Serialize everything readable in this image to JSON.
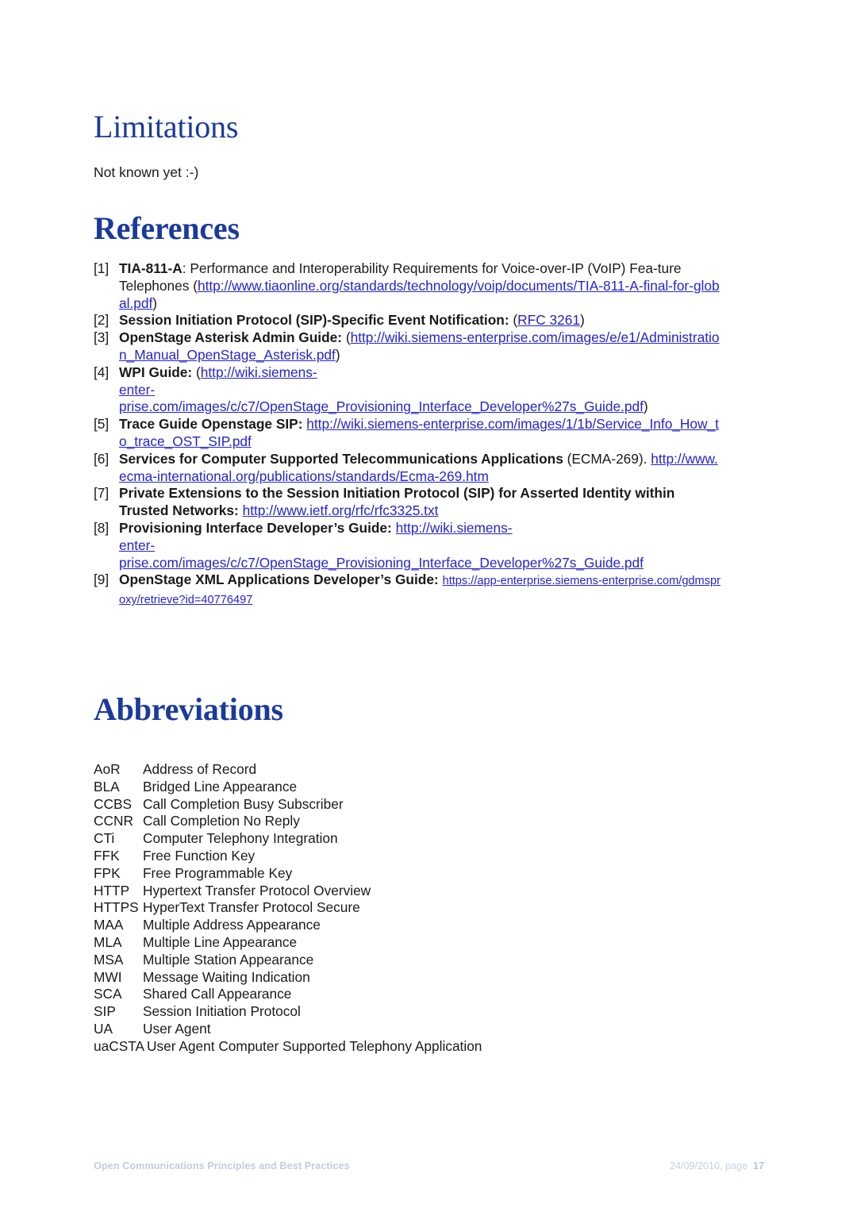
{
  "page": {
    "background": "#ffffff",
    "heading_color": "#1a3a9c",
    "link_color": "#2424cf",
    "text_color": "#1a1a1a",
    "footer_color": "#c3ccdd"
  },
  "sections": {
    "limitations": {
      "heading": "Limitations",
      "paragraph": "Not known yet :-)"
    },
    "references": {
      "heading": "References"
    },
    "abbreviations": {
      "heading": "Abbreviations"
    }
  },
  "references": [
    {
      "num": "[1]",
      "title": "TIA-811-A",
      "after_title": ": Performance and Interoperability Requirements for Voice-over-IP (VoIP) Fea-ture Telephones (",
      "link": "http://www.tiaonline.org/standards/technology/voip/documents/TIA-811-A-final-for-global.pdf",
      "tail": ")"
    },
    {
      "num": "[2]",
      "title": "Session Initiation Protocol (SIP)-Specific Event Notification:",
      "after_title": " (",
      "link": "RFC 3261",
      "tail": ")"
    },
    {
      "num": "[3]",
      "title": "OpenStage Asterisk Admin Guide:",
      "after_title": " (",
      "link": "http://wiki.siemens-enterprise.com/images/e/e1/Administration_Manual_OpenStage_Asterisk.pdf",
      "tail": ")"
    },
    {
      "num": "[4]",
      "title": "WPI Guide:",
      "after_title": " (",
      "link_part1": "http://wiki.siemens-",
      "link_part2": "enter-",
      "link_part3": "prise.com/images/c/c7/OpenStage_Provisioning_Interface_Developer%27s_Guide.pdf",
      "tail": ")"
    },
    {
      "num": "[5]",
      "title": "Trace Guide Openstage SIP:",
      "after_title": " ",
      "link": "http://wiki.siemens-enterprise.com/images/1/1b/Service_Info_How_to_trace_OST_SIP.pdf",
      "tail": ""
    },
    {
      "num": "[6]",
      "title": "Services for Computer Supported Telecommunications Applications",
      "after_title": " (ECMA-269). ",
      "link": "http://www.ecma-international.org/publications/standards/Ecma-269.htm",
      "tail": ""
    },
    {
      "num": "[7]",
      "title": "Private Extensions to the Session Initiation Protocol (SIP) for Asserted Identity within Trusted Networks:",
      "after_title": " ",
      "link": "http://www.ietf.org/rfc/rfc3325.txt",
      "tail": ""
    },
    {
      "num": "[8]",
      "title": "Provisioning Interface Developer’s Guide:",
      "after_title": " ",
      "link_part1": "http://wiki.siemens-",
      "link_part2": "enter-",
      "link_part3": "prise.com/images/c/c7/OpenStage_Provisioning_Interface_Developer%27s_Guide.pdf",
      "tail": ""
    },
    {
      "num": "[9]",
      "title": "OpenStage XML Applications Developer’s Guide:",
      "after_title": " ",
      "link": "https://app-enterprise.siemens-enterprise.com/gdmsproxy/retrieve?id=40776497",
      "tail": ""
    }
  ],
  "abbreviations": [
    {
      "key": "AoR",
      "value": "Address of Record"
    },
    {
      "key": "BLA",
      "value": "Bridged Line Appearance"
    },
    {
      "key": "CCBS",
      "value": "Call Completion Busy Subscriber"
    },
    {
      "key": "CCNR",
      "value": "Call Completion No Reply"
    },
    {
      "key": "CTi",
      "value": "Computer Telephony Integration"
    },
    {
      "key": "FFK",
      "value": "Free Function Key"
    },
    {
      "key": "FPK",
      "value": "Free Programmable Key"
    },
    {
      "key": "HTTP",
      "value": "Hypertext Transfer Protocol Overview"
    },
    {
      "key": "HTTPS",
      "value": "HyperText Transfer Protocol Secure"
    },
    {
      "key": "MAA",
      "value": "Multiple Address Appearance"
    },
    {
      "key": "MLA",
      "value": "Multiple Line Appearance"
    },
    {
      "key": "MSA",
      "value": "Multiple Station Appearance"
    },
    {
      "key": "MWI",
      "value": "Message Waiting Indication"
    },
    {
      "key": "SCA",
      "value": "Shared Call Appearance"
    },
    {
      "key": "SIP",
      "value": "Session Initiation Protocol"
    },
    {
      "key": "UA",
      "value": "User Agent"
    },
    {
      "key": "uaCSTA",
      "value": "User Agent Computer Supported Telephony Application",
      "wide": true
    }
  ],
  "footer": {
    "left": "Open Communications Principles and Best Practices",
    "date_label": "24/09/2010, page",
    "page_number": "17"
  }
}
